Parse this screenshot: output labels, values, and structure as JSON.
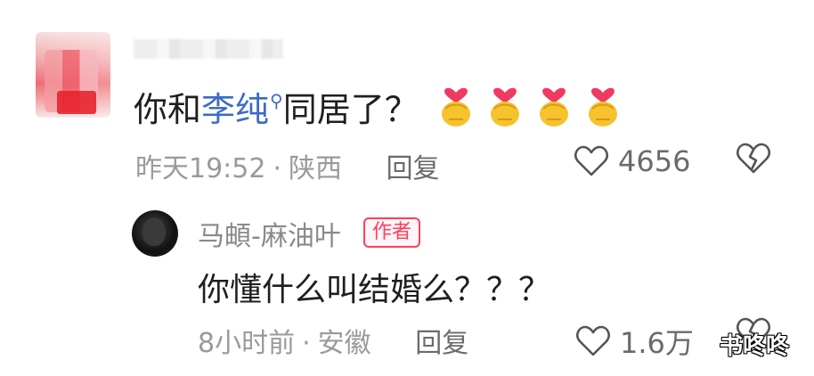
{
  "comment": {
    "text_before_mention": "你和",
    "mention": "李纯",
    "text_after_mention": "同居了？",
    "emoji_count": 4,
    "emoji_name": "heart-hands-emoji",
    "time": "昨天19:52",
    "separator": "·",
    "location": "陕西",
    "reply_label": "回复",
    "like_count": "4656"
  },
  "reply": {
    "author_name": "马頔-麻油叶",
    "author_badge": "作者",
    "text": "你懂什么叫结婚么？？？",
    "time": "8小时前",
    "separator": "·",
    "location": "安徽",
    "reply_label": "回复",
    "like_count": "1.6万"
  },
  "watermark": "书咚咚",
  "colors": {
    "mention": "#3b6cc7",
    "badge": "#ff3f5a",
    "meta_text": "#9a9a9a"
  }
}
